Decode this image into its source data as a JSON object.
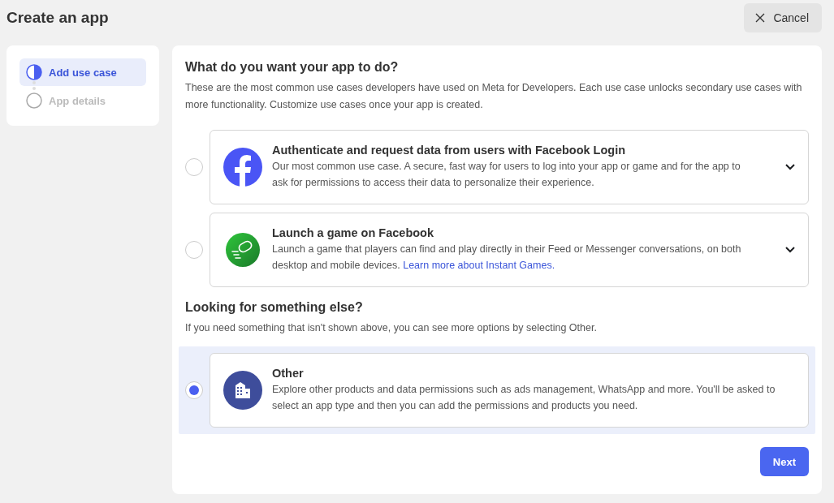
{
  "title": "Create an app",
  "cancel_button": "Cancel",
  "steps": [
    {
      "label": "Add use case",
      "selected": true
    },
    {
      "label": "App details",
      "selected": false
    }
  ],
  "heading": "What do you want your app to do?",
  "intro": "These are the most common use cases developers have used on Meta for Developers. Each use case unlocks secondary use cases with more functionality. Customize use cases once your app is created.",
  "use_cases": [
    {
      "kind": "facebook",
      "title": "Authenticate and request data from users with Facebook Login",
      "description": "Our most common use case. A secure, fast way for users to log into your app or game and for the app to ask for permissions to access their data to personalize their experience.",
      "selected": false,
      "expandable": true
    },
    {
      "kind": "game",
      "title": "Launch a game on Facebook",
      "description": "Launch a game that players can find and play directly in their Feed or Messenger conversations, on both desktop and mobile devices.",
      "link": "Learn more about Instant Games.",
      "selected": false,
      "expandable": true
    }
  ],
  "other_heading": "Looking for something else?",
  "other_intro": "If you need something that isn't shown above, you can see more options by selecting Other.",
  "other_cases": [
    {
      "kind": "building",
      "title": "Other",
      "description": "Explore other products and data permissions such as ads management, WhatsApp and more. You'll be asked to select an app type and then you can add the permissions and products you need.",
      "selected": true,
      "expandable": false
    }
  ],
  "next_button": "Next"
}
